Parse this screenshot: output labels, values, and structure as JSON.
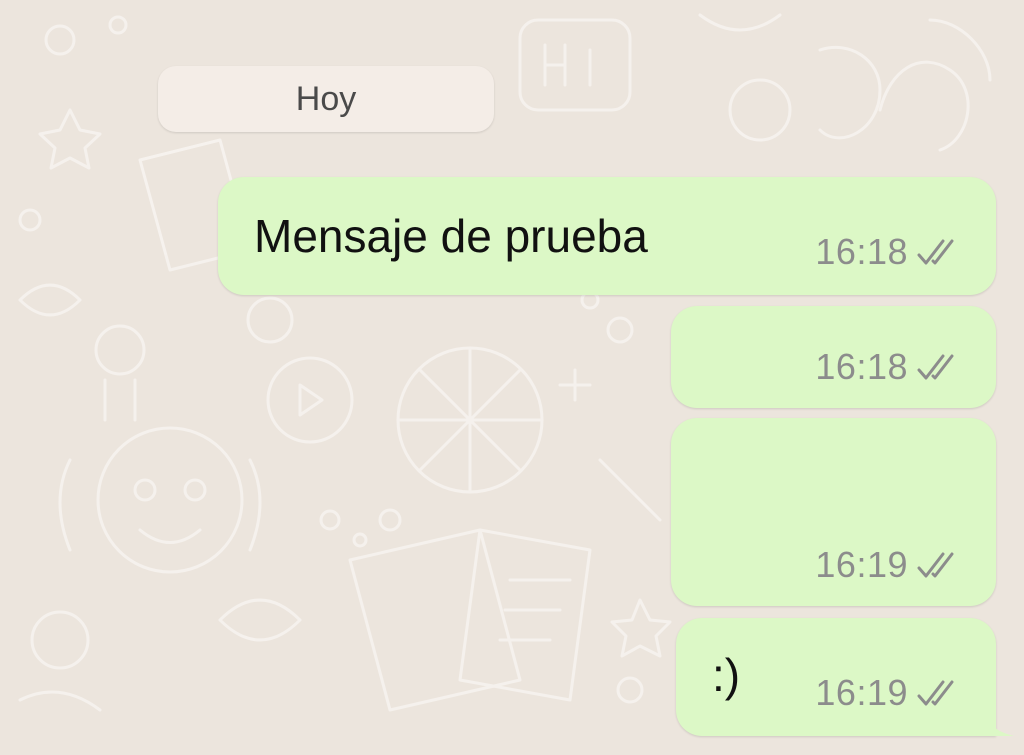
{
  "chat": {
    "date_separator": "Hoy",
    "messages": [
      {
        "text": "Mensaje de prueba",
        "time": "16:18",
        "status_icon": "double-check-icon"
      },
      {
        "text": "",
        "time": "16:18",
        "status_icon": "double-check-icon"
      },
      {
        "text": "",
        "time": "16:19",
        "status_icon": "double-check-icon"
      },
      {
        "text": ":)",
        "time": "16:19",
        "status_icon": "double-check-icon"
      }
    ]
  },
  "colors": {
    "background": "#ece5dd",
    "outgoing_bubble": "#dcf8c6",
    "date_chip": "#f4ede7",
    "meta_text": "#8c8c8c"
  }
}
